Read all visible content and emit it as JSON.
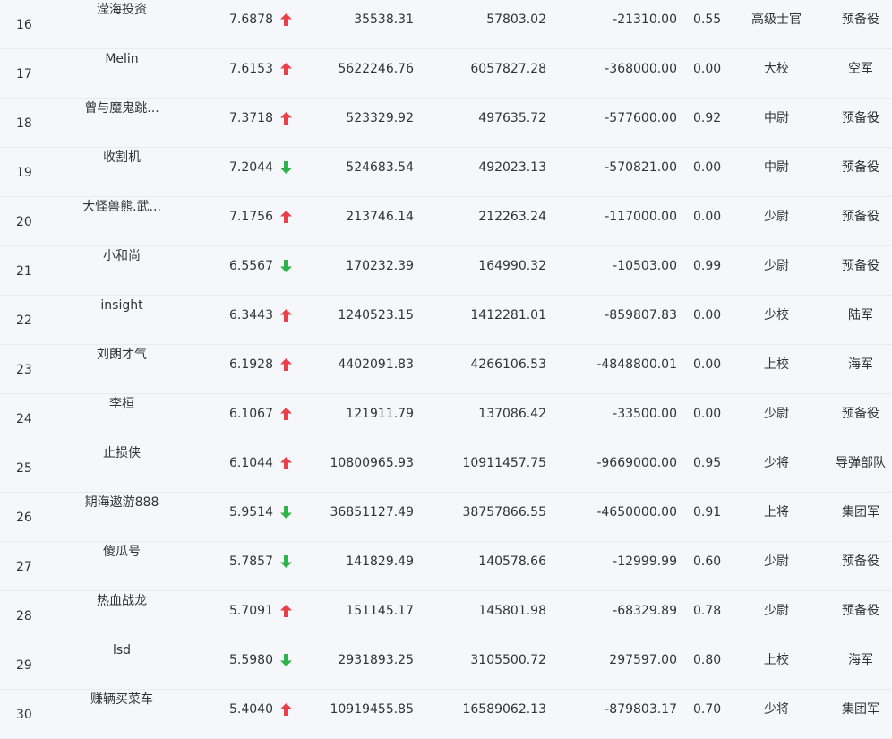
{
  "colors": {
    "up": "#e8404a",
    "down": "#30b24a",
    "background": "#f5f7fa",
    "text": "#333333"
  },
  "rows": [
    {
      "rank": "16",
      "name": "滢海投资",
      "score": "7.6878",
      "trend": "up",
      "v1": "35538.31",
      "v2": "57803.02",
      "v3": "-21310.00",
      "ratio": "0.55",
      "military_rank": "高级士官",
      "branch": "预备役"
    },
    {
      "rank": "17",
      "name": "Melin",
      "score": "7.6153",
      "trend": "up",
      "v1": "5622246.76",
      "v2": "6057827.28",
      "v3": "-368000.00",
      "ratio": "0.00",
      "military_rank": "大校",
      "branch": "空军"
    },
    {
      "rank": "18",
      "name": "曾与魔鬼跳...",
      "score": "7.3718",
      "trend": "up",
      "v1": "523329.92",
      "v2": "497635.72",
      "v3": "-577600.00",
      "ratio": "0.92",
      "military_rank": "中尉",
      "branch": "预备役"
    },
    {
      "rank": "19",
      "name": "收割机",
      "score": "7.2044",
      "trend": "down",
      "v1": "524683.54",
      "v2": "492023.13",
      "v3": "-570821.00",
      "ratio": "0.00",
      "military_rank": "中尉",
      "branch": "预备役"
    },
    {
      "rank": "20",
      "name": "大怪兽熊.武...",
      "score": "7.1756",
      "trend": "up",
      "v1": "213746.14",
      "v2": "212263.24",
      "v3": "-117000.00",
      "ratio": "0.00",
      "military_rank": "少尉",
      "branch": "预备役"
    },
    {
      "rank": "21",
      "name": "小和尚",
      "score": "6.5567",
      "trend": "down",
      "v1": "170232.39",
      "v2": "164990.32",
      "v3": "-10503.00",
      "ratio": "0.99",
      "military_rank": "少尉",
      "branch": "预备役"
    },
    {
      "rank": "22",
      "name": "insight",
      "score": "6.3443",
      "trend": "up",
      "v1": "1240523.15",
      "v2": "1412281.01",
      "v3": "-859807.83",
      "ratio": "0.00",
      "military_rank": "少校",
      "branch": "陆军"
    },
    {
      "rank": "23",
      "name": "刘朗才气",
      "score": "6.1928",
      "trend": "up",
      "v1": "4402091.83",
      "v2": "4266106.53",
      "v3": "-4848800.01",
      "ratio": "0.00",
      "military_rank": "上校",
      "branch": "海军"
    },
    {
      "rank": "24",
      "name": "李桓",
      "score": "6.1067",
      "trend": "up",
      "v1": "121911.79",
      "v2": "137086.42",
      "v3": "-33500.00",
      "ratio": "0.00",
      "military_rank": "少尉",
      "branch": "预备役"
    },
    {
      "rank": "25",
      "name": "止损侠",
      "score": "6.1044",
      "trend": "up",
      "v1": "10800965.93",
      "v2": "10911457.75",
      "v3": "-9669000.00",
      "ratio": "0.95",
      "military_rank": "少将",
      "branch": "导弹部队"
    },
    {
      "rank": "26",
      "name": "期海遨游888",
      "score": "5.9514",
      "trend": "down",
      "v1": "36851127.49",
      "v2": "38757866.55",
      "v3": "-4650000.00",
      "ratio": "0.91",
      "military_rank": "上将",
      "branch": "集团军"
    },
    {
      "rank": "27",
      "name": "傻瓜号",
      "score": "5.7857",
      "trend": "down",
      "v1": "141829.49",
      "v2": "140578.66",
      "v3": "-12999.99",
      "ratio": "0.60",
      "military_rank": "少尉",
      "branch": "预备役"
    },
    {
      "rank": "28",
      "name": "热血战龙",
      "score": "5.7091",
      "trend": "up",
      "v1": "151145.17",
      "v2": "145801.98",
      "v3": "-68329.89",
      "ratio": "0.78",
      "military_rank": "少尉",
      "branch": "预备役"
    },
    {
      "rank": "29",
      "name": "lsd",
      "score": "5.5980",
      "trend": "down",
      "v1": "2931893.25",
      "v2": "3105500.72",
      "v3": "297597.00",
      "ratio": "0.80",
      "military_rank": "上校",
      "branch": "海军"
    },
    {
      "rank": "30",
      "name": "赚辆买菜车",
      "score": "5.4040",
      "trend": "up",
      "v1": "10919455.85",
      "v2": "16589062.13",
      "v3": "-879803.17",
      "ratio": "0.70",
      "military_rank": "少将",
      "branch": "集团军"
    }
  ]
}
